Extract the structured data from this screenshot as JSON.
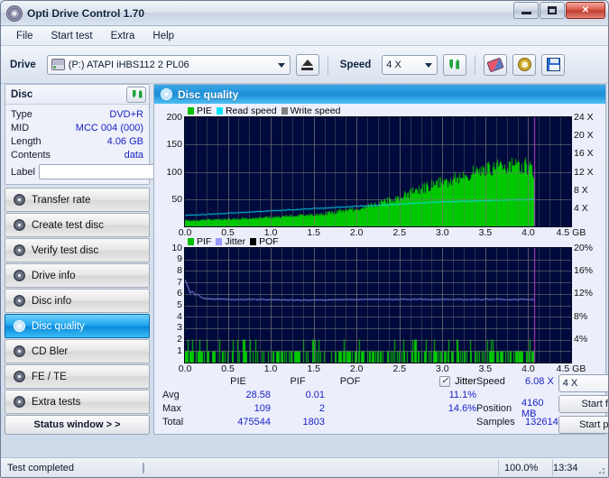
{
  "window": {
    "title": "Opti Drive Control 1.70",
    "icon": "disc-icon",
    "buttons": {
      "minimize": "–",
      "maximize": "□",
      "close": "✕"
    }
  },
  "menu": {
    "items": [
      "File",
      "Start test",
      "Extra",
      "Help"
    ]
  },
  "toolbar": {
    "drive_label": "Drive",
    "drive_value": "(P:)  ATAPI iHBS112  2 PL06",
    "speed_label": "Speed",
    "speed_value": "4 X",
    "icons": [
      "eject-icon",
      "refresh-icon",
      "erase-icon",
      "settings-icon",
      "save-icon"
    ]
  },
  "disc": {
    "title": "Disc",
    "refresh_icon": "refresh-icon",
    "rows": [
      {
        "key": "Type",
        "value": "DVD+R"
      },
      {
        "key": "MID",
        "value": "MCC 004 (000)"
      },
      {
        "key": "Length",
        "value": "4.06 GB"
      },
      {
        "key": "Contents",
        "value": "data"
      }
    ],
    "label_key": "Label",
    "label_value": "",
    "label_placeholder": ""
  },
  "nav": {
    "items": [
      {
        "label": "Transfer rate",
        "active": false
      },
      {
        "label": "Create test disc",
        "active": false
      },
      {
        "label": "Verify test disc",
        "active": false
      },
      {
        "label": "Drive info",
        "active": false
      },
      {
        "label": "Disc info",
        "active": false
      },
      {
        "label": "Disc quality",
        "active": true
      },
      {
        "label": "CD Bler",
        "active": false
      },
      {
        "label": "FE / TE",
        "active": false
      },
      {
        "label": "Extra tests",
        "active": false
      }
    ],
    "status_window_button": "Status window > >"
  },
  "panel": {
    "title": "Disc quality",
    "icon": "disc-icon"
  },
  "stats": {
    "columns": [
      "",
      "PIE",
      "PIF",
      "POF",
      "Jitter"
    ],
    "jitter_checked": true,
    "rows": [
      {
        "label": "Avg",
        "pie": "28.58",
        "pif": "0.01",
        "pof": "",
        "jitter": "11.1%"
      },
      {
        "label": "Max",
        "pie": "109",
        "pif": "2",
        "pof": "",
        "jitter": "14.6%"
      },
      {
        "label": "Total",
        "pie": "475544",
        "pif": "1803",
        "pof": "",
        "jitter": ""
      }
    ]
  },
  "results": {
    "speed_key": "Speed",
    "speed_value": "6.08 X",
    "speed_select": "4 X",
    "position_key": "Position",
    "position_value": "4160 MB",
    "samples_key": "Samples",
    "samples_value": "132614",
    "start_full": "Start full",
    "start_part": "Start part"
  },
  "statusbar": {
    "text": "Test completed",
    "progress_percent": "100.0%",
    "progress_value": 100,
    "elapsed": "13:34"
  },
  "chart_data": [
    {
      "type": "area",
      "id": "pie-chart",
      "title": "",
      "xlabel": "GB",
      "ylabel": "PIE",
      "xlim": [
        0,
        4.5
      ],
      "ylim": [
        0,
        200
      ],
      "y2lim": [
        0,
        24
      ],
      "y2label": "X",
      "xticks": [
        0.0,
        0.5,
        1.0,
        1.5,
        2.0,
        2.5,
        3.0,
        3.5,
        4.0,
        4.5
      ],
      "xticklabels": [
        "0.0",
        "0.5",
        "1.0",
        "1.5",
        "2.0",
        "2.5",
        "3.0",
        "3.5",
        "4.0",
        "4.5 GB"
      ],
      "yticks": [
        50,
        100,
        150,
        200
      ],
      "yticklabels": [
        "50",
        "100",
        "150",
        "200"
      ],
      "y2ticks": [
        4,
        8,
        12,
        16,
        20,
        24
      ],
      "y2ticklabels": [
        "4 X",
        "8 X",
        "12 X",
        "16 X",
        "20 X",
        "24 X"
      ],
      "grid": true,
      "bg": "#000a3c",
      "legend": [
        {
          "name": "PIE",
          "color": "#00c000"
        },
        {
          "name": "Read speed",
          "color": "#00e5ff"
        },
        {
          "name": "Write speed",
          "color": "#808080"
        }
      ],
      "data_end_x": 4.07,
      "series": [
        {
          "name": "PIE",
          "kind": "area",
          "color": "#00c800",
          "x": [
            0.0,
            0.1,
            0.2,
            0.3,
            0.4,
            0.5,
            0.6,
            0.7,
            0.8,
            0.9,
            1.0,
            1.1,
            1.2,
            1.3,
            1.4,
            1.5,
            1.6,
            1.7,
            1.8,
            1.9,
            2.0,
            2.1,
            2.2,
            2.3,
            2.4,
            2.5,
            2.6,
            2.7,
            2.8,
            2.9,
            3.0,
            3.1,
            3.2,
            3.3,
            3.4,
            3.5,
            3.6,
            3.7,
            3.8,
            3.9,
            4.0,
            4.07
          ],
          "values": [
            11,
            10,
            11,
            12,
            12,
            13,
            13,
            14,
            15,
            15,
            16,
            17,
            18,
            19,
            20,
            21,
            22,
            24,
            26,
            28,
            31,
            34,
            38,
            42,
            47,
            52,
            58,
            63,
            68,
            73,
            78,
            83,
            88,
            92,
            96,
            99,
            102,
            105,
            107,
            108,
            106,
            95
          ]
        },
        {
          "name": "Read speed",
          "kind": "line",
          "color": "#00e5ff",
          "axis": "y2",
          "x": [
            0.0,
            0.2,
            0.4,
            0.6,
            0.8,
            1.0,
            1.2,
            1.4,
            1.6,
            1.8,
            2.0,
            2.2,
            2.4,
            2.6,
            2.8,
            3.0,
            3.2,
            3.4,
            3.6,
            3.8,
            4.0,
            4.07
          ],
          "values": [
            2.5,
            2.7,
            2.9,
            3.1,
            3.3,
            3.5,
            3.7,
            3.9,
            4.1,
            4.3,
            4.5,
            4.7,
            4.9,
            5.1,
            5.3,
            5.5,
            5.6,
            5.7,
            5.8,
            5.9,
            6.0,
            6.08
          ]
        }
      ]
    },
    {
      "type": "bar",
      "id": "pif-chart",
      "title": "",
      "xlabel": "GB",
      "ylabel": "PIF",
      "xlim": [
        0,
        4.5
      ],
      "ylim": [
        0,
        10
      ],
      "y2lim": [
        0,
        20
      ],
      "y2label": "%",
      "xticks": [
        0.0,
        0.5,
        1.0,
        1.5,
        2.0,
        2.5,
        3.0,
        3.5,
        4.0,
        4.5
      ],
      "xticklabels": [
        "0.0",
        "0.5",
        "1.0",
        "1.5",
        "2.0",
        "2.5",
        "3.0",
        "3.5",
        "4.0",
        "4.5 GB"
      ],
      "yticks": [
        1,
        2,
        3,
        4,
        5,
        6,
        7,
        8,
        9,
        10
      ],
      "yticklabels": [
        "1",
        "2",
        "3",
        "4",
        "5",
        "6",
        "7",
        "8",
        "9",
        "10"
      ],
      "y2ticks": [
        4,
        8,
        12,
        16,
        20
      ],
      "y2ticklabels": [
        "4%",
        "8%",
        "12%",
        "16%",
        "20%"
      ],
      "grid": true,
      "bg": "#000a3c",
      "legend": [
        {
          "name": "PIF",
          "color": "#00c000"
        },
        {
          "name": "Jitter",
          "color": "#9a9aff"
        },
        {
          "name": "POF",
          "color": "#000000"
        }
      ],
      "data_end_x": 4.07,
      "series": [
        {
          "name": "PIF",
          "kind": "bars",
          "color": "#00c800",
          "note": "dense spikes of height 1-2 across the whole surface"
        },
        {
          "name": "Jitter",
          "kind": "line",
          "color": "#9a9aff",
          "axis": "y2",
          "x": [
            0.0,
            0.03,
            0.06,
            0.09,
            0.12,
            0.15,
            0.2,
            0.3,
            0.5,
            0.8,
            1.2,
            1.6,
            2.0,
            2.4,
            2.8,
            3.2,
            3.6,
            4.0,
            4.07
          ],
          "values": [
            14.6,
            13.5,
            12.2,
            12.6,
            11.8,
            12.0,
            11.3,
            11.2,
            11.1,
            11.1,
            11.0,
            11.0,
            11.1,
            11.1,
            11.1,
            11.1,
            11.1,
            11.1,
            11.1
          ]
        }
      ]
    }
  ]
}
